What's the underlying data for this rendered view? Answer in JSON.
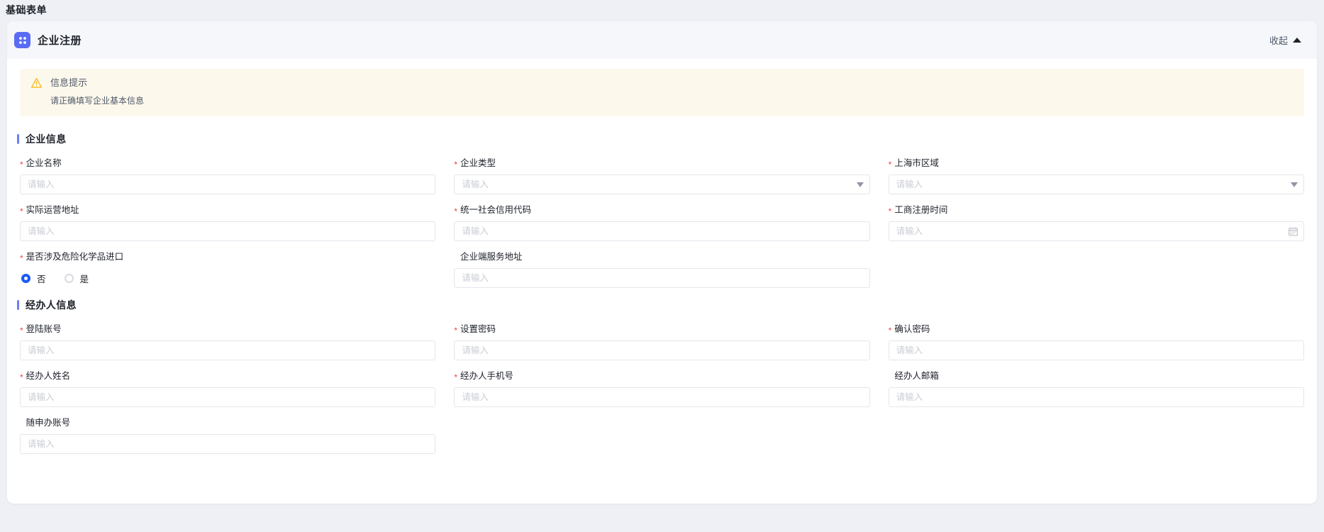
{
  "breadcrumb": {
    "title": "基础表单"
  },
  "card": {
    "icon": "apps-grid-icon",
    "title": "企业注册",
    "collapse_label": "收起",
    "collapse_icon": "caret-up-icon"
  },
  "alert": {
    "icon": "warning-triangle-icon",
    "title": "信息提示",
    "description": "请正确填写企业基本信息",
    "bg_color": "#fdf8ec",
    "icon_color": "#f7ba1e"
  },
  "theme": {
    "accent": "#5a6cf3",
    "section_bar": "#6a7ef0",
    "required_star": "#f53f3f",
    "radio_checked": "#1d5bf5",
    "page_bg": "#eef0f5",
    "header_bg": "#f6f7fa"
  },
  "placeholder": "请输入",
  "sections": [
    {
      "title": "企业信息",
      "fields": [
        {
          "label": "企业名称",
          "required": true,
          "type": "text",
          "value": "",
          "placeholder": "请输入"
        },
        {
          "label": "企业类型",
          "required": true,
          "type": "select",
          "value": "",
          "placeholder": "请输入",
          "icon": "chevron-down-icon"
        },
        {
          "label": "上海市区域",
          "required": true,
          "type": "select",
          "value": "",
          "placeholder": "请输入",
          "icon": "chevron-down-icon"
        },
        {
          "label": "实际运营地址",
          "required": true,
          "type": "text",
          "value": "",
          "placeholder": "请输入"
        },
        {
          "label": "统一社会信用代码",
          "required": true,
          "type": "text",
          "value": "",
          "placeholder": "请输入"
        },
        {
          "label": "工商注册时间",
          "required": true,
          "type": "date",
          "value": "",
          "placeholder": "请输入",
          "icon": "calendar-icon"
        },
        {
          "label": "是否涉及危险化学品进口",
          "required": true,
          "type": "radio",
          "options": [
            {
              "label": "否",
              "checked": true
            },
            {
              "label": "是",
              "checked": false
            }
          ]
        },
        {
          "label": "企业端服务地址",
          "required": false,
          "type": "text",
          "value": "",
          "placeholder": "请输入"
        }
      ]
    },
    {
      "title": "经办人信息",
      "fields": [
        {
          "label": "登陆账号",
          "required": true,
          "type": "text",
          "value": "",
          "placeholder": "请输入"
        },
        {
          "label": "设置密码",
          "required": true,
          "type": "text",
          "value": "",
          "placeholder": "请输入"
        },
        {
          "label": "确认密码",
          "required": true,
          "type": "text",
          "value": "",
          "placeholder": "请输入"
        },
        {
          "label": "经办人姓名",
          "required": true,
          "type": "text",
          "value": "",
          "placeholder": "请输入"
        },
        {
          "label": "经办人手机号",
          "required": true,
          "type": "text",
          "value": "",
          "placeholder": "请输入"
        },
        {
          "label": "经办人邮箱",
          "required": false,
          "type": "text",
          "value": "",
          "placeholder": "请输入"
        },
        {
          "label": "随申办账号",
          "required": false,
          "type": "text",
          "value": "",
          "placeholder": "请输入"
        }
      ]
    }
  ]
}
